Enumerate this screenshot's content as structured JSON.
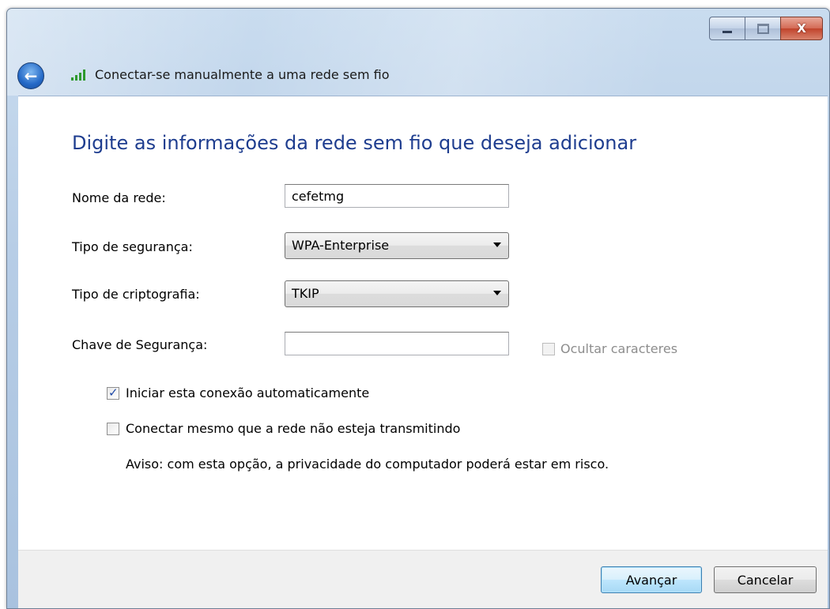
{
  "window": {
    "title": "Conectar-se manualmente a uma rede sem fio",
    "caption_buttons": {
      "minimize": "minimize",
      "maximize": "maximize",
      "close": "X"
    }
  },
  "heading": "Digite as informações da rede sem fio que deseja adicionar",
  "form": {
    "network_name": {
      "label": "Nome da rede:",
      "value": "cefetmg"
    },
    "security_type": {
      "label": "Tipo de segurança:",
      "value": "WPA-Enterprise"
    },
    "encryption_type": {
      "label": "Tipo de criptografia:",
      "value": "TKIP"
    },
    "security_key": {
      "label": "Chave de Segurança:",
      "value": ""
    },
    "hide_chars": {
      "label": "Ocultar caracteres",
      "checked": false,
      "enabled": false
    }
  },
  "options": {
    "auto_start": {
      "label": "Iniciar esta conexão automaticamente",
      "checked": true
    },
    "connect_hidden": {
      "label": "Conectar mesmo que a rede não esteja transmitindo",
      "checked": false
    },
    "warning": "Aviso: com esta opção, a privacidade do computador poderá estar em risco."
  },
  "buttons": {
    "next": "Avançar",
    "cancel": "Cancelar"
  },
  "icons": {
    "back": "back-arrow-icon",
    "signal": "wireless-signal-icon"
  },
  "colors": {
    "heading": "#1e3d8f",
    "frame": "#b7cde6",
    "footer": "#f0f0f0"
  }
}
